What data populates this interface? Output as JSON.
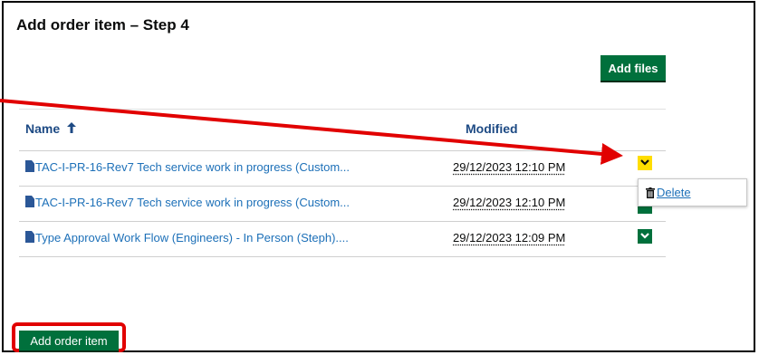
{
  "dialog": {
    "title": "Add order item – Step 4"
  },
  "toolbar": {
    "add_files_label": "Add files"
  },
  "table": {
    "columns": {
      "name": "Name",
      "modified": "Modified"
    },
    "rows": [
      {
        "name": "TAC-I-PR-16-Rev7 Tech service work in progress (Custom...",
        "modified": "29/12/2023 12:10 PM"
      },
      {
        "name": "TAC-I-PR-16-Rev7 Tech service work in progress (Custom...",
        "modified": "29/12/2023 12:10 PM"
      },
      {
        "name": "Type Approval Work Flow (Engineers) - In Person (Steph)....",
        "modified": "29/12/2023 12:09 PM"
      }
    ]
  },
  "dropdown": {
    "delete_label": "Delete"
  },
  "footer": {
    "add_order_item_label": "Add order item"
  },
  "colors": {
    "accent_green": "#00703c",
    "link_blue": "#1d70b8",
    "focus_yellow": "#ffdd00",
    "annotation_red": "#e10000"
  },
  "icons": {
    "file": "file-icon",
    "sort": "sort-ascending-icon",
    "chevron": "chevron-down-icon",
    "trash": "trash-icon"
  }
}
